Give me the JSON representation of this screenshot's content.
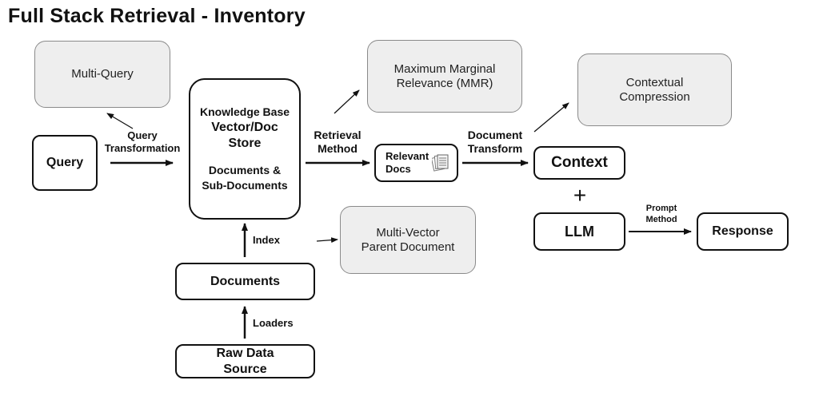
{
  "title": "Full Stack Retrieval - Inventory",
  "nodes": {
    "query": "Query",
    "knowledge_base": {
      "line1": "Knowledge Base",
      "line2": "Vector/Doc",
      "line3": "Store",
      "line4": "Documents &",
      "line5": "Sub-Documents"
    },
    "relevant_docs": {
      "line1": "Relevant",
      "line2": "Docs"
    },
    "context": "Context",
    "llm": "LLM",
    "response": "Response",
    "documents": "Documents",
    "raw_data_source": {
      "line1": "Raw Data",
      "line2": "Source"
    }
  },
  "alternatives": {
    "multi_query": "Multi-Query",
    "mmr": {
      "line1": "Maximum Marginal",
      "line2": "Relevance (MMR)"
    },
    "contextual_compression": {
      "line1": "Contextual",
      "line2": "Compression"
    },
    "multi_vector": {
      "line1": "Multi-Vector",
      "line2": "Parent Document"
    }
  },
  "edge_labels": {
    "query_transformation": {
      "line1": "Query",
      "line2": "Transformation"
    },
    "retrieval_method": {
      "line1": "Retrieval",
      "line2": "Method"
    },
    "document_transform": {
      "line1": "Document",
      "line2": "Transform"
    },
    "prompt_method": {
      "line1": "Prompt",
      "line2": "Method"
    },
    "index": "Index",
    "loaders": "Loaders",
    "plus": "+"
  },
  "icons": {
    "relevant_docs": "documents-stack-icon"
  }
}
